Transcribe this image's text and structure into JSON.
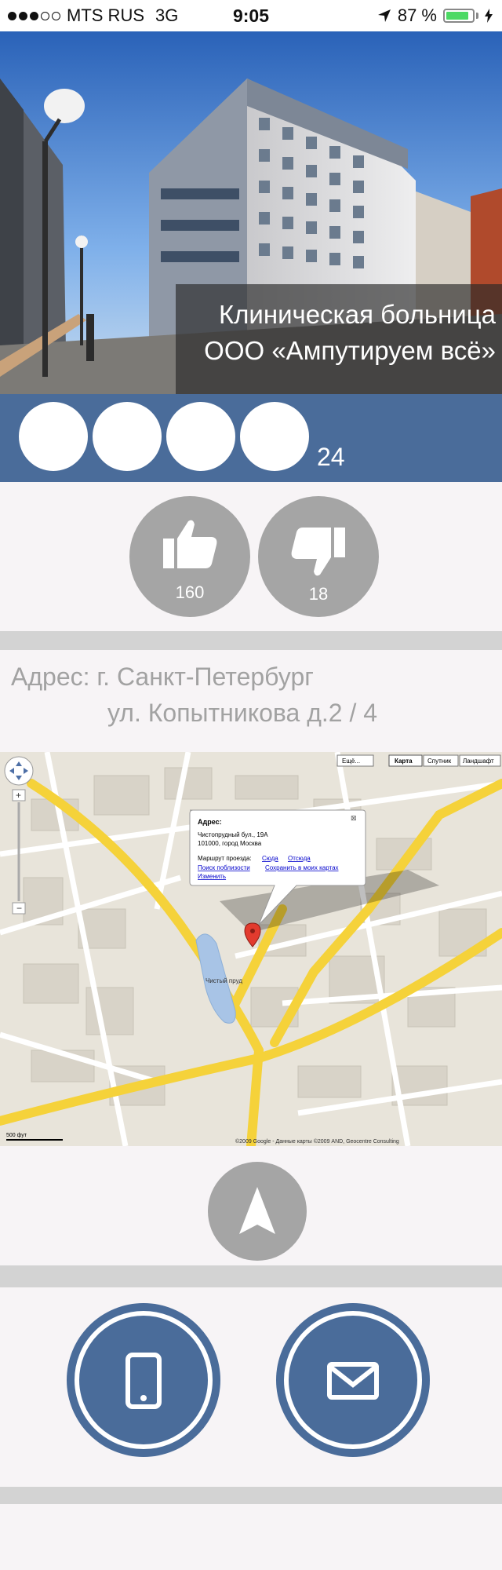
{
  "status_bar": {
    "carrier": "MTS RUS",
    "network": "3G",
    "time": "9:05",
    "battery": "87 %",
    "battery_level": 0.87
  },
  "clinic": {
    "title_line1": "Клиническая больница",
    "title_line2": "ООО «Ампутируем всё»"
  },
  "rating": {
    "count": "24",
    "stars_shown": 4
  },
  "votes": {
    "likes": "160",
    "dislikes": "18"
  },
  "address": {
    "line1": "Адрес: г. Санкт-Петербург",
    "line2": "ул. Копытникова д.2 / 4"
  },
  "map": {
    "type_buttons": [
      "Ещё...",
      "Карта",
      "Спутник",
      "Ландшафт"
    ],
    "popup_title": "Адрес:",
    "popup_line1": "Чистопрудный бул., 19А",
    "popup_line2": "101000, город Москва",
    "popup_route_label": "Маршрут проезда:",
    "popup_route_here": "Сюда",
    "popup_route_from": "Отсюда",
    "popup_nearby": "Поиск поблизости",
    "popup_save": "Сохранить в моих картах",
    "popup_edit": "Изменить",
    "pond_label": "Чистый пруд",
    "scale_label": "500 фут",
    "copyright": "©2009 Google - Данные карты ©2009 AND, Geocentre Consulting"
  },
  "colors": {
    "accent": "#4a6c9a",
    "button_gray": "#a5a5a5",
    "separator": "#d3d3d3",
    "background": "#f7f4f6"
  },
  "icons": {
    "like": "thumbs-up-icon",
    "dislike": "thumbs-down-icon",
    "navigate": "navigation-arrow-icon",
    "phone": "phone-icon",
    "mail": "mail-icon"
  }
}
